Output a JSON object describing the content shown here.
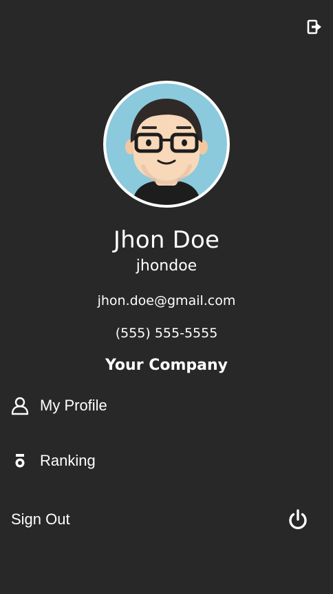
{
  "header": {
    "logout_icon": "logout-icon"
  },
  "profile": {
    "avatar_icon": "avatar",
    "name": "Jhon Doe",
    "username": "jhondoe",
    "email": "jhon.doe@gmail.com",
    "phone": "(555) 555-5555",
    "company": "Your Company"
  },
  "menu": {
    "items": [
      {
        "label": "My Profile",
        "icon": "user-icon"
      },
      {
        "label": "Ranking",
        "icon": "medal-icon"
      }
    ],
    "sign_out_label": "Sign Out",
    "sign_out_icon": "power-icon"
  },
  "colors": {
    "background": "#282828",
    "text": "#ffffff",
    "avatar_bg": "#8bc9dc",
    "avatar_border": "#ffffff"
  }
}
